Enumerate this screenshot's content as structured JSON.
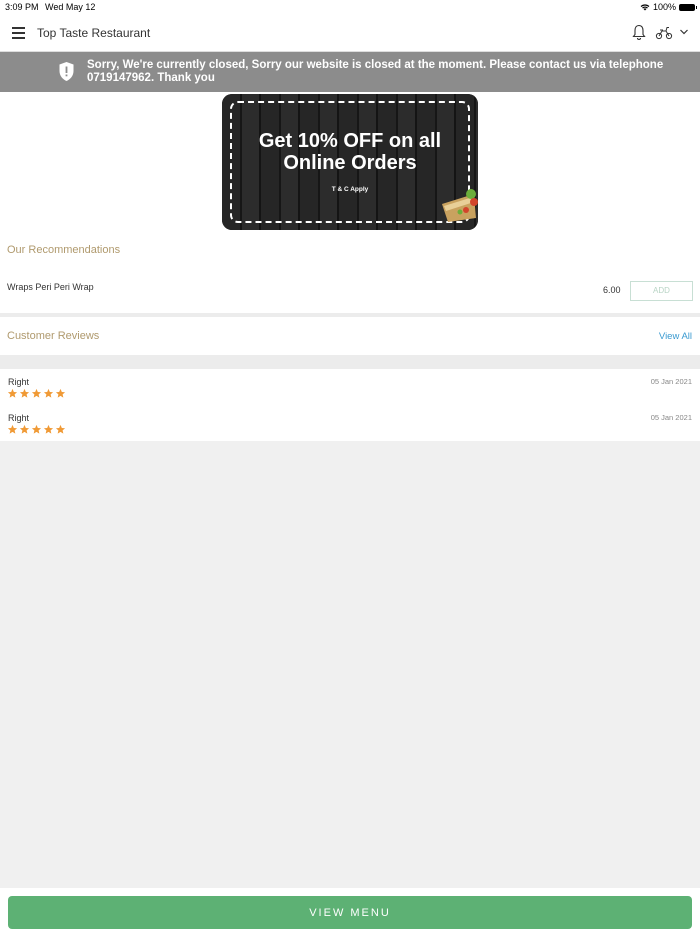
{
  "status_bar": {
    "time": "3:09 PM",
    "date": "Wed May 12",
    "battery": "100%"
  },
  "header": {
    "restaurant_name": "Top Taste Restaurant",
    "icons": [
      "menu-icon",
      "bell-icon",
      "scooter-icon",
      "chevron-down-icon"
    ]
  },
  "closed_notice": {
    "text": "Sorry, We're currently closed, Sorry our website is closed at the moment. Please contact us via telephone 0719147962. Thank you",
    "icon": "shield-alert-icon"
  },
  "promo": {
    "title_line1": "Get 10% OFF on all",
    "title_line2": "Online Orders",
    "terms": "T & C Apply"
  },
  "recommendations": {
    "title": "Our Recommendations",
    "items": [
      {
        "name": "Wraps Peri Peri Wrap",
        "price": "6.00",
        "add_label": "ADD"
      }
    ]
  },
  "reviews": {
    "title": "Customer Reviews",
    "view_all_label": "View All",
    "items": [
      {
        "name": "Right",
        "date": "05 Jan 2021",
        "rating": 5
      },
      {
        "name": "Right",
        "date": "05 Jan 2021",
        "rating": 5
      }
    ]
  },
  "footer": {
    "view_menu_label": "VIEW MENU"
  },
  "colors": {
    "accent_green": "#5db174",
    "banner_gray": "#8c8c8c",
    "section_title": "#b09a6e",
    "link_blue": "#3a9ad0",
    "star_orange": "#f09a36"
  }
}
